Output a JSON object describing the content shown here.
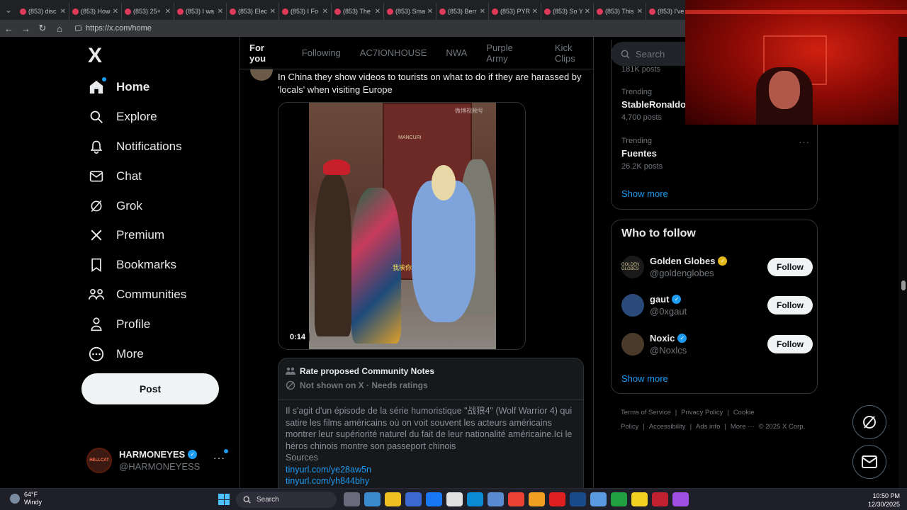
{
  "browser": {
    "tabs": [
      {
        "label": "(853) disc"
      },
      {
        "label": "(853) How"
      },
      {
        "label": "(853) 25+"
      },
      {
        "label": "(853) I wa"
      },
      {
        "label": "(853) Elec"
      },
      {
        "label": "(853) I Fo"
      },
      {
        "label": "(853) The"
      },
      {
        "label": "(853) Sma"
      },
      {
        "label": "(853) Berr"
      },
      {
        "label": "(853) PYR"
      },
      {
        "label": "(853) So Y"
      },
      {
        "label": "(853) This"
      },
      {
        "label": "(853) I've"
      }
    ],
    "url": "https://x.com/home"
  },
  "sidebar": {
    "logo": "X",
    "items": [
      {
        "label": "Home",
        "icon": "home-icon"
      },
      {
        "label": "Explore",
        "icon": "search-icon"
      },
      {
        "label": "Notifications",
        "icon": "bell-icon"
      },
      {
        "label": "Chat",
        "icon": "mail-icon"
      },
      {
        "label": "Grok",
        "icon": "grok-icon"
      },
      {
        "label": "Premium",
        "icon": "x-icon"
      },
      {
        "label": "Bookmarks",
        "icon": "bookmark-icon"
      },
      {
        "label": "Communities",
        "icon": "people-icon"
      },
      {
        "label": "Profile",
        "icon": "person-icon"
      },
      {
        "label": "More",
        "icon": "more-circle-icon"
      }
    ],
    "post_label": "Post",
    "account": {
      "display_name": "HARMONEYES",
      "handle": "@HARMONEYESS",
      "avatar_text": "HELLCAT"
    }
  },
  "main": {
    "tabs": [
      "For you",
      "Following",
      "AC7IONHOUSE",
      "NWA",
      "Purple Army",
      "Kick Clips"
    ],
    "post": {
      "text": "In China they show videos to tourists on what to do if they are harassed by 'locals' when visiting Europe",
      "video_time": "0:14",
      "video_subtitle": "我挨你",
      "video_watermark": "微博视频号",
      "door_sign": "MANCURI"
    },
    "community_note": {
      "title": "Rate proposed Community Notes",
      "status": "Not shown on X · Needs ratings",
      "body": "Il s'agit d'un épisode de la série humoristique \"战狼4\" (Wolf Warrior 4) qui satire les films américains où on voit souvent les acteurs américains montrer leur supériorité naturel du fait de leur nationalité américaine.Ici le héros chinois montre son passeport chinois",
      "sources_label": "Sources",
      "links": [
        "tinyurl.com/ye28aw5n",
        "tinyurl.com/yh844bhy"
      ]
    }
  },
  "right": {
    "search_placeholder": "Search",
    "trends_partial_count": "181K posts",
    "trends": [
      {
        "category": "Trending",
        "name": "StableRonaldo",
        "count": "4,700 posts"
      },
      {
        "category": "Trending",
        "name": "Fuentes",
        "count": "26.2K posts"
      }
    ],
    "show_more": "Show more",
    "who_to_follow": {
      "title": "Who to follow",
      "accounts": [
        {
          "name": "Golden Globes",
          "handle": "@goldenglobes",
          "badge": "gold",
          "avatar_text": "GOLDEN GLOBES",
          "avatar_color": "#1a1a1a"
        },
        {
          "name": "gaut",
          "handle": "@0xgaut",
          "badge": "blue",
          "avatar_text": "",
          "avatar_color": "#2a4a7a"
        },
        {
          "name": "Noxic",
          "handle": "@Noxlcs",
          "badge": "blue",
          "avatar_text": "",
          "avatar_color": "#4a3a2a"
        }
      ],
      "follow_label": "Follow",
      "show_more": "Show more"
    },
    "footer": [
      "Terms of Service",
      "|",
      "Privacy Policy",
      "|",
      "Cookie Policy",
      "|",
      "Accessibility",
      "|",
      "Ads info",
      "|",
      "More ···",
      "© 2025 X Corp."
    ]
  },
  "taskbar": {
    "temp": "64°F",
    "condition": "Windy",
    "search": "Search",
    "time": "10:50 PM",
    "date": "12/30/2025",
    "app_colors": [
      "#6a6a7a",
      "#3a8ad0",
      "#f0c020",
      "#3a6ad0",
      "#1877f2",
      "#e0e0e0",
      "#0a8ad0",
      "#5a8ad0",
      "#ea4335",
      "#f0a020",
      "#e02020",
      "#1a4a8a",
      "#5a9ae0",
      "#20a040",
      "#f0d020",
      "#c02030",
      "#a050e0"
    ]
  },
  "colors": {
    "accent": "#1d9bf0",
    "background": "#000000",
    "border": "#2f3336",
    "muted": "#71767b"
  }
}
